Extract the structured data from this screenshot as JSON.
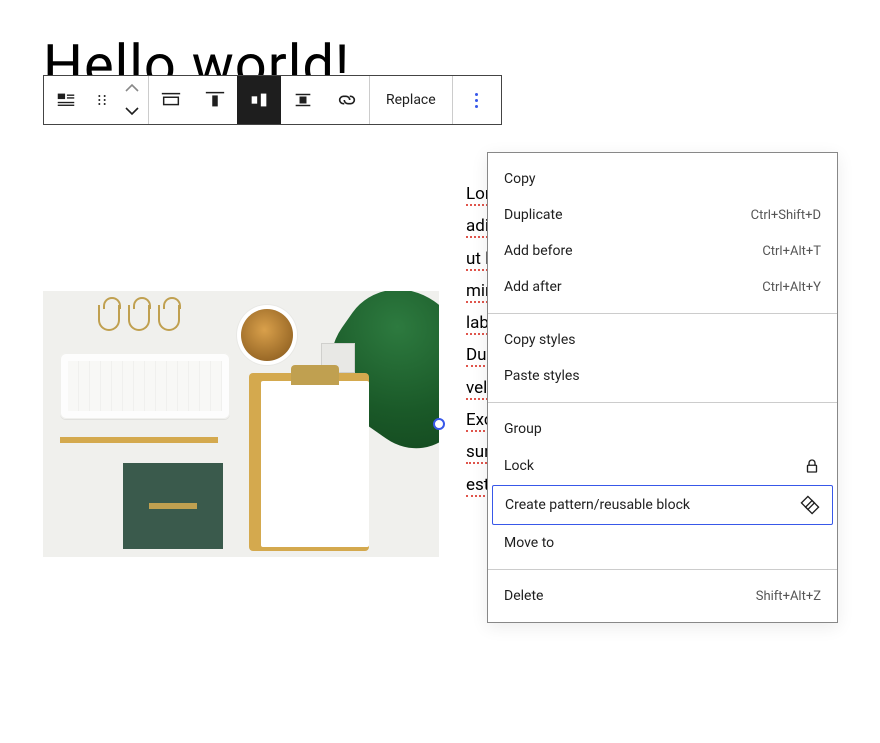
{
  "page_title": "Hello world!",
  "toolbar": {
    "replace_label": "Replace"
  },
  "content_text": "Lorem ipsum dolor sit amet, consectetur adipiscing elit, sed do eiusmod tempor incididunt ut labore et dolore magna aliqua. Ut enim ad minim veniam, quis nostrud exercitation ullamco laboris nisi ut aliquip ex ea commodo consequat. Duis aute irure dolor in reprehenderit in voluptate velit esse cillum dolore eu fugiat nulla pariatur. Excepteur sint occaecat cupidatat non proident, sunt in culpa qui officia deserunt mollit anim id est laborum.",
  "dropdown": {
    "sections": [
      {
        "items": [
          {
            "label": "Copy",
            "shortcut": ""
          },
          {
            "label": "Duplicate",
            "shortcut": "Ctrl+Shift+D"
          },
          {
            "label": "Add before",
            "shortcut": "Ctrl+Alt+T"
          },
          {
            "label": "Add after",
            "shortcut": "Ctrl+Alt+Y"
          }
        ]
      },
      {
        "items": [
          {
            "label": "Copy styles",
            "shortcut": ""
          },
          {
            "label": "Paste styles",
            "shortcut": ""
          }
        ]
      },
      {
        "items": [
          {
            "label": "Group",
            "shortcut": ""
          },
          {
            "label": "Lock",
            "shortcut": "",
            "icon": "lock"
          },
          {
            "label": "Create pattern/reusable block",
            "shortcut": "",
            "icon": "pattern",
            "highlighted": true
          },
          {
            "label": "Move to",
            "shortcut": ""
          }
        ]
      },
      {
        "items": [
          {
            "label": "Delete",
            "shortcut": "Shift+Alt+Z"
          }
        ]
      }
    ]
  }
}
